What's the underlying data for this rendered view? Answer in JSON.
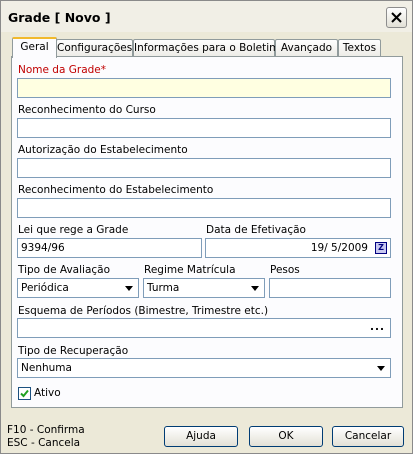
{
  "window": {
    "title": "Grade [ Novo ]"
  },
  "tabs": [
    {
      "label": "Geral",
      "active": true
    },
    {
      "label": "Configurações"
    },
    {
      "label": "Informações para o Boletim"
    },
    {
      "label": "Avançado"
    },
    {
      "label": "Textos"
    }
  ],
  "form": {
    "nome_label": "Nome da Grade*",
    "nome_value": "",
    "reconhecimento_curso_label": "Reconhecimento do Curso",
    "reconhecimento_curso_value": "",
    "autorizacao_label": "Autorização do Estabelecimento",
    "autorizacao_value": "",
    "reconhecimento_estab_label": "Reconhecimento do Estabelecimento",
    "reconhecimento_estab_value": "",
    "lei_label": "Lei que rege a Grade",
    "lei_value": "9394/96",
    "data_label": "Data de Efetivação",
    "data_value": "19/ 5/2009",
    "tipo_avaliacao_label": "Tipo de Avaliação",
    "tipo_avaliacao_value": "Periódica",
    "regime_label": "Regime Matrícula",
    "regime_value": "Turma",
    "pesos_label": "Pesos",
    "pesos_value": "",
    "esquema_label": "Esquema de Períodos (Bimestre, Trimestre etc.)",
    "esquema_value": "",
    "esquema_button": "...",
    "recuperacao_label": "Tipo de Recuperação",
    "recuperacao_value": "Nenhuma",
    "ativo_label": "Ativo",
    "ativo_checked": true,
    "calendar_glyph": "Z"
  },
  "status": {
    "line1": "F10 - Confirma",
    "line2": "ESC - Cancela"
  },
  "buttons": {
    "help": "Ajuda",
    "ok": "OK",
    "cancel": "Cancelar"
  },
  "colors": {
    "required_label": "#c00000",
    "required_field_bg": "#ffffe1",
    "active_tab_accent": "#f1b92c"
  }
}
